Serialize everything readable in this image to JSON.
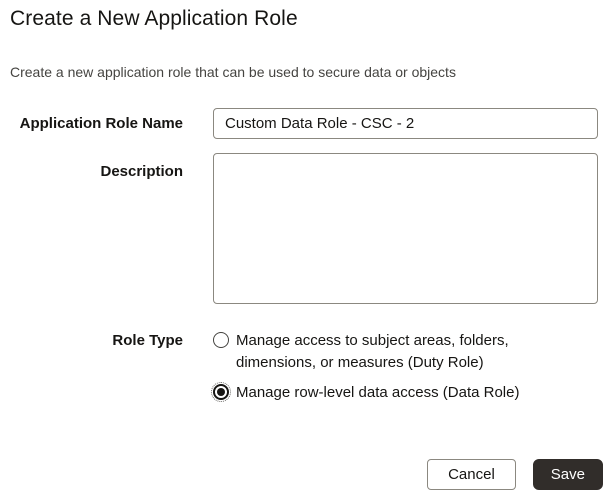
{
  "dialog": {
    "title": "Create a New Application Role",
    "subtitle": "Create a new application role that can be used to secure data or objects",
    "fields": {
      "name": {
        "label": "Application Role Name",
        "value": "Custom Data Role - CSC - 2"
      },
      "description": {
        "label": "Description",
        "value": ""
      },
      "role_type": {
        "label": "Role Type",
        "options": [
          {
            "label": "Manage access to subject areas, folders, dimensions, or measures (Duty Role)",
            "selected": false
          },
          {
            "label": "Manage row-level data access (Data Role)",
            "selected": true
          }
        ]
      }
    },
    "buttons": {
      "cancel": "Cancel",
      "save": "Save"
    },
    "colors": {
      "text": "#161513",
      "subtitle_text": "#454441",
      "field_border": "#8b8880",
      "save_background": "#312d2a",
      "save_text": "#ffffff"
    }
  }
}
